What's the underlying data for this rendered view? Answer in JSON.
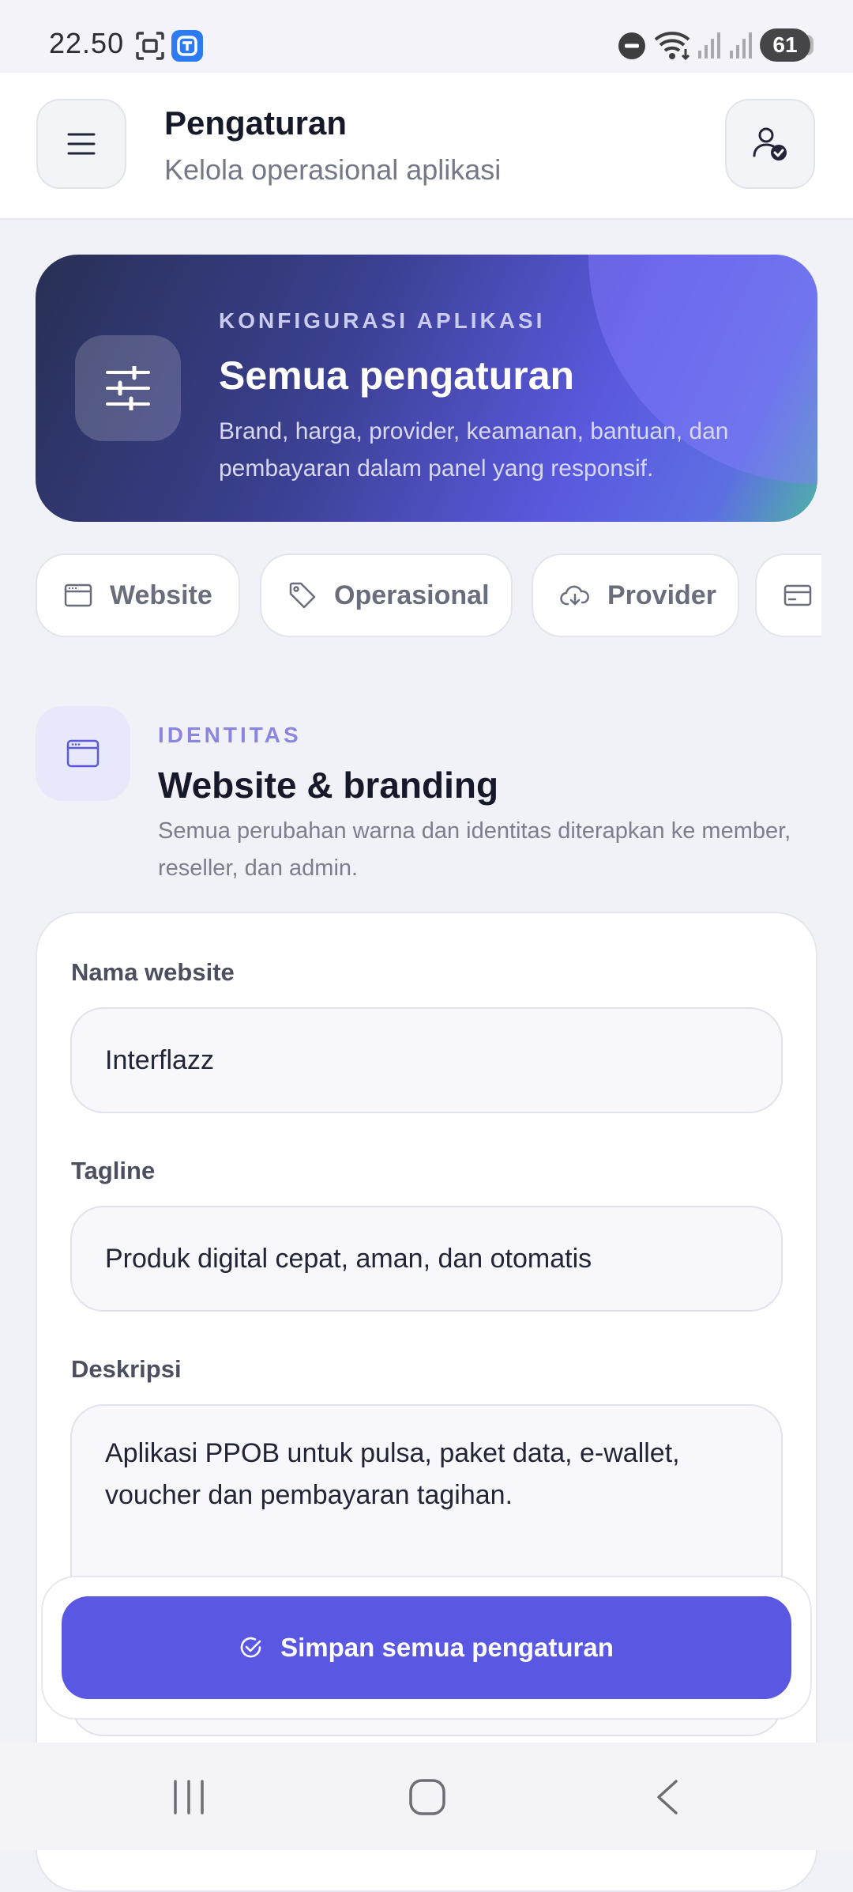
{
  "status_bar": {
    "time": "22.50",
    "battery": "61"
  },
  "header": {
    "title": "Pengaturan",
    "subtitle": "Kelola operasional aplikasi"
  },
  "hero": {
    "kicker": "KONFIGURASI APLIKASI",
    "title": "Semua pengaturan",
    "description": "Brand, harga, provider, keamanan, bantuan, dan pembayaran dalam panel yang responsif."
  },
  "tabs": [
    {
      "label": "Website",
      "icon": "browser-window-icon"
    },
    {
      "label": "Operasional",
      "icon": "tag-icon"
    },
    {
      "label": "Provider",
      "icon": "cloud-download-icon"
    },
    {
      "label": "",
      "icon": "credit-card-icon"
    }
  ],
  "section": {
    "kicker": "IDENTITAS",
    "title": "Website & branding",
    "description": "Semua perubahan warna dan identitas diterapkan ke member, reseller, dan admin."
  },
  "form": {
    "site_name": {
      "label": "Nama website",
      "value": "Interflazz"
    },
    "tagline": {
      "label": "Tagline",
      "value": "Produk digital cepat, aman, dan otomatis"
    },
    "description": {
      "label": "Deskripsi",
      "value": "Aplikasi PPOB untuk pulsa, paket data, e-wallet, voucher dan pembayaran tagihan."
    }
  },
  "save_button": {
    "label": "Simpan semua pengaturan"
  },
  "colors": {
    "primary": "#5a57e3",
    "hero_dark": "#283055",
    "accent_teal": "#4fb2a6"
  }
}
